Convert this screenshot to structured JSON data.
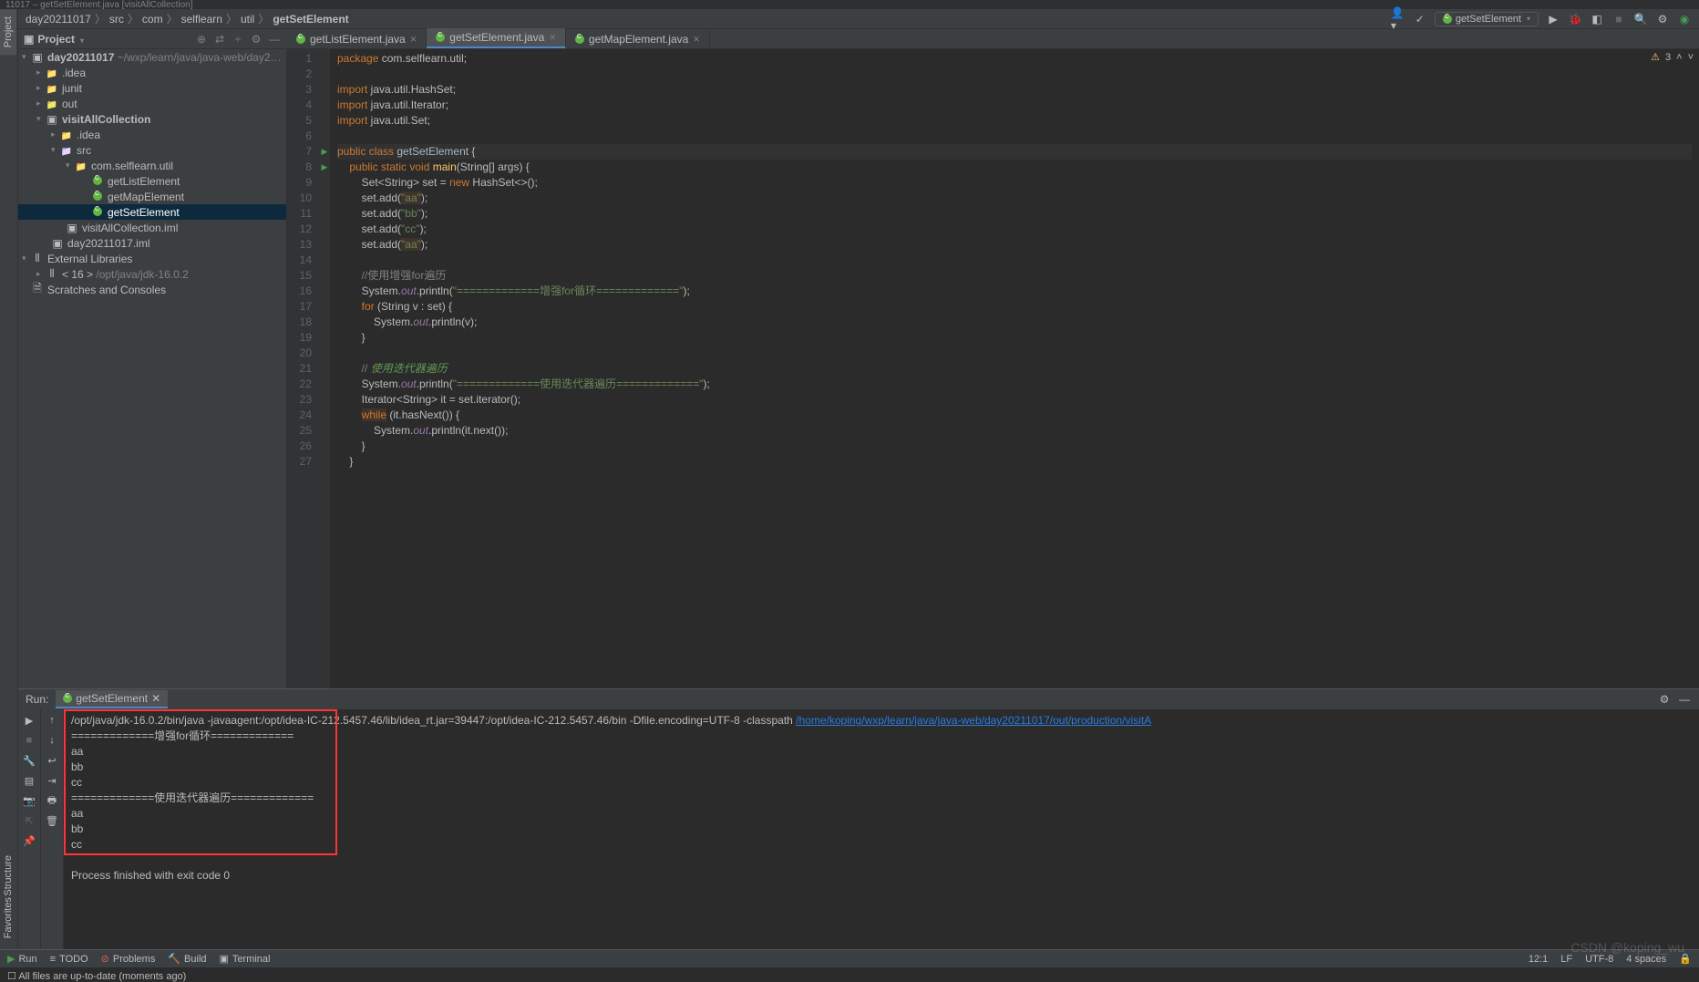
{
  "titleRemnant": "11017 – getSetElement.java [visitAllCollection]",
  "breadcrumb": {
    "parts": [
      "day20211017",
      "src",
      "com",
      "selflearn",
      "util",
      "getSetElement"
    ]
  },
  "runConfig": "getSetElement",
  "inspector": {
    "warnings": "3"
  },
  "sidebar_tabs": {
    "project": "Project",
    "structure": "Structure",
    "favorites": "Favorites"
  },
  "project": {
    "title": "Project",
    "root": {
      "name": "day20211017",
      "path": "~/wxp/learn/java/java-web/day2…"
    },
    "idea": ".idea",
    "junit": "junit",
    "out": "out",
    "module": "visitAllCollection",
    "idea2": ".idea",
    "src": "src",
    "pkg": "com.selflearn.util",
    "f1": "getListElement",
    "f2": "getMapElement",
    "f3": "getSetElement",
    "iml": "visitAllCollection.iml",
    "iml2": "day20211017.iml",
    "ext": "External Libraries",
    "jdk_label": "< 16 >",
    "jdk_path": "/opt/java/jdk-16.0.2",
    "scratches": "Scratches and Consoles"
  },
  "tabs": [
    {
      "name": "getListElement.java"
    },
    {
      "name": "getSetElement.java",
      "active": true
    },
    {
      "name": "getMapElement.java"
    }
  ],
  "code": {
    "lines": [
      {
        "n": 1,
        "html": "<span class='kw'>package</span> com.selflearn.util;"
      },
      {
        "n": 2,
        "html": ""
      },
      {
        "n": 3,
        "html": "<span class='kw'>import</span> java.util.HashSet;"
      },
      {
        "n": 4,
        "html": "<span class='kw'>import</span> java.util.Iterator;"
      },
      {
        "n": 5,
        "html": "<span class='kw'>import</span> java.util.Set;"
      },
      {
        "n": 6,
        "html": ""
      },
      {
        "n": 7,
        "html": "<span class='kw'>public class</span> <span class='cls'>getSetElement</span> {",
        "hl": true,
        "run": true
      },
      {
        "n": 8,
        "html": "    <span class='kw'>public static void</span> <span class='meth'>main</span>(String[] args) {",
        "run": true
      },
      {
        "n": 9,
        "html": "        Set&lt;String&gt; set = <span class='kw'>new</span> HashSet&lt;&gt;();"
      },
      {
        "n": 10,
        "html": "        set.add(<span class='str hl-y'>\"aa\"</span>);"
      },
      {
        "n": 11,
        "html": "        set.add(<span class='str'>\"bb\"</span>);"
      },
      {
        "n": 12,
        "html": "        set.add(<span class='str'>\"cc\"</span>);"
      },
      {
        "n": 13,
        "html": "        set.add(<span class='str hl-y'>\"aa\"</span>);"
      },
      {
        "n": 14,
        "html": ""
      },
      {
        "n": 15,
        "html": "        <span class='com'>//使用增强for遍历</span>"
      },
      {
        "n": 16,
        "html": "        System.<span class='fld'>out</span>.println(<span class='str'>\"=============增强for循环=============\"</span>);"
      },
      {
        "n": 17,
        "html": "        <span class='kw'>for</span> (String v : set) {"
      },
      {
        "n": 18,
        "html": "            System.<span class='fld'>out</span>.println(v);"
      },
      {
        "n": 19,
        "html": "        }"
      },
      {
        "n": 20,
        "html": ""
      },
      {
        "n": 21,
        "html": "        <span class='com'>// </span><span class='com2'>使用迭代器遍历</span>"
      },
      {
        "n": 22,
        "html": "        System.<span class='fld'>out</span>.println(<span class='str'>\"=============使用迭代器遍历=============\"</span>);"
      },
      {
        "n": 23,
        "html": "        Iterator&lt;String&gt; it = set.iterator();"
      },
      {
        "n": 24,
        "html": "        <span class='kw hl-y'>while</span> (it.hasNext()) {"
      },
      {
        "n": 25,
        "html": "            System.<span class='fld'>out</span>.println(it.next());"
      },
      {
        "n": 26,
        "html": "        }"
      },
      {
        "n": 27,
        "html": "    }"
      }
    ]
  },
  "run": {
    "label": "Run:",
    "tab": "getSetElement",
    "cmd_prefix": "/opt/java/jdk-16.0.2/bin/java -javaagent:/opt/idea-IC-212.5457.46/lib/idea_rt.jar=39447:/opt/idea-IC-212.5457.46/bin -Dfile.encoding=UTF-8 -classpath ",
    "cmd_link": "/home/koping/wxp/learn/java/java-web/day20211017/out/production/visitA",
    "out": [
      "=============增强for循环=============",
      "aa",
      "bb",
      "cc",
      "=============使用迭代器遍历=============",
      "aa",
      "bb",
      "cc"
    ],
    "exit": "Process finished with exit code 0"
  },
  "statusBar": {
    "run": "Run",
    "todo": "TODO",
    "problems": "Problems",
    "build": "Build",
    "terminal": "Terminal",
    "msg": "All files are up-to-date (moments ago)",
    "pos": "12:1",
    "le": "LF",
    "enc": "UTF-8",
    "indent": "4 spaces"
  },
  "watermark": "CSDN @koping_wu"
}
